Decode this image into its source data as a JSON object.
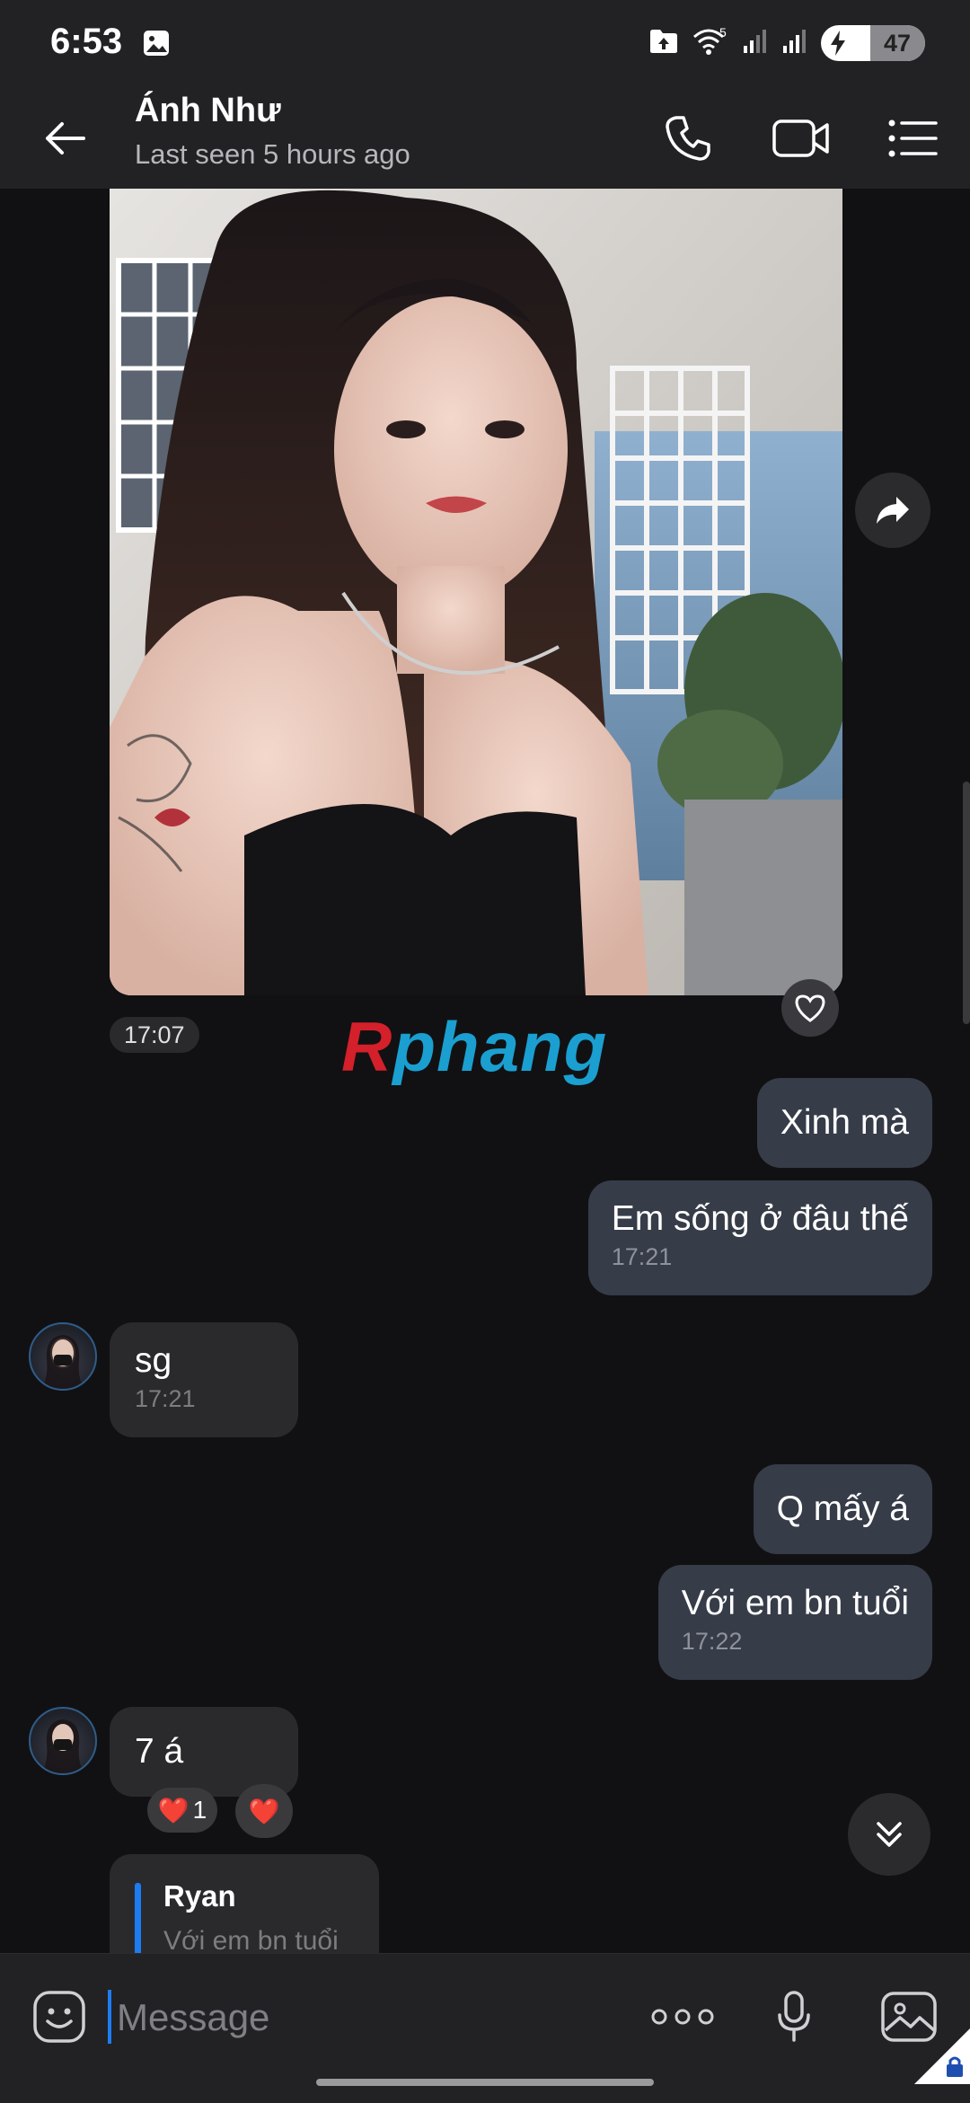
{
  "status_bar": {
    "time": "6:53",
    "battery": "47",
    "battery_level": 0.47,
    "network_badge": "5"
  },
  "header": {
    "contact_name": "Ánh Như",
    "status": "Last seen 5 hours ago"
  },
  "messages": {
    "photo_time": "17:07",
    "m1": {
      "text": "Xinh mà"
    },
    "m2": {
      "text": "Em sống ở đâu thế",
      "time": "17:21"
    },
    "m3": {
      "text": "sg",
      "time": "17:21"
    },
    "m4": {
      "text": "Q mấy á"
    },
    "m5": {
      "text": "Với em bn tuổi",
      "time": "17:22"
    },
    "m6": {
      "text": "7 á",
      "reactions": [
        {
          "emoji": "❤️",
          "count": "1"
        },
        {
          "emoji": "❤️"
        }
      ]
    },
    "reply_preview": {
      "author": "Ryan",
      "quote": "Với em bn tuổi"
    }
  },
  "watermark": {
    "r": "R",
    "rest": "phang"
  },
  "input": {
    "placeholder": "Message"
  },
  "colors": {
    "accent": "#1e7cf2",
    "bubble_out": "#363c48",
    "bubble_in": "#2a2a2c",
    "bg": "#111113",
    "bar": "#222224"
  }
}
